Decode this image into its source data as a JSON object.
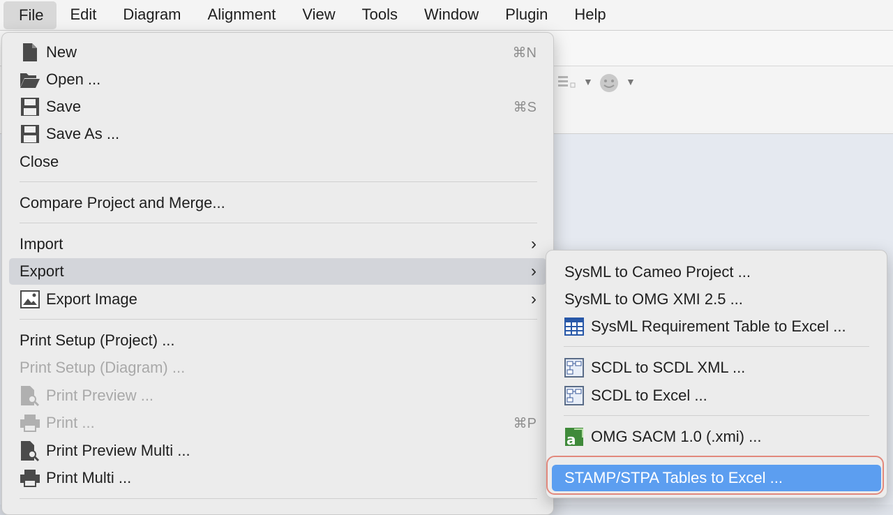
{
  "menubar": {
    "items": [
      "File",
      "Edit",
      "Diagram",
      "Alignment",
      "View",
      "Tools",
      "Window",
      "Plugin",
      "Help"
    ]
  },
  "file_menu": {
    "new": {
      "label": "New",
      "shortcut": "⌘N",
      "icon": "new-document-icon"
    },
    "open": {
      "label": "Open ...",
      "icon": "open-folder-icon"
    },
    "save": {
      "label": "Save",
      "shortcut": "⌘S",
      "icon": "save-icon"
    },
    "save_as": {
      "label": "Save As ...",
      "icon": "save-as-icon"
    },
    "close": {
      "label": "Close"
    },
    "compare": {
      "label": "Compare Project and Merge..."
    },
    "import": {
      "label": "Import"
    },
    "export": {
      "label": "Export"
    },
    "export_image": {
      "label": "Export Image",
      "icon": "image-icon"
    },
    "print_setup_project": {
      "label": "Print Setup (Project) ..."
    },
    "print_setup_diagram": {
      "label": "Print Setup (Diagram) ..."
    },
    "print_preview": {
      "label": "Print Preview ...",
      "icon": "print-preview-icon"
    },
    "print": {
      "label": "Print ...",
      "shortcut": "⌘P",
      "icon": "printer-icon"
    },
    "print_preview_multi": {
      "label": "Print Preview Multi ...",
      "icon": "print-preview-icon"
    },
    "print_multi": {
      "label": "Print Multi ...",
      "icon": "printer-icon"
    }
  },
  "export_submenu": {
    "items": [
      {
        "label": "SysML to Cameo Project ..."
      },
      {
        "label": "SysML to OMG XMI 2.5 ..."
      },
      {
        "label": "SysML Requirement Table to Excel ...",
        "icon": "table-icon"
      },
      {
        "label": "SCDL to SCDL XML ...",
        "icon": "scdl-icon"
      },
      {
        "label": "SCDL to Excel ...",
        "icon": "scdl-icon"
      },
      {
        "label": "OMG SACM 1.0 (.xmi) ...",
        "icon": "sacm-icon"
      },
      {
        "label": "STAMP/STPA Tables to Excel ..."
      }
    ]
  },
  "colors": {
    "selection": "#5c9ef0",
    "focus_ring": "#e2897d"
  }
}
